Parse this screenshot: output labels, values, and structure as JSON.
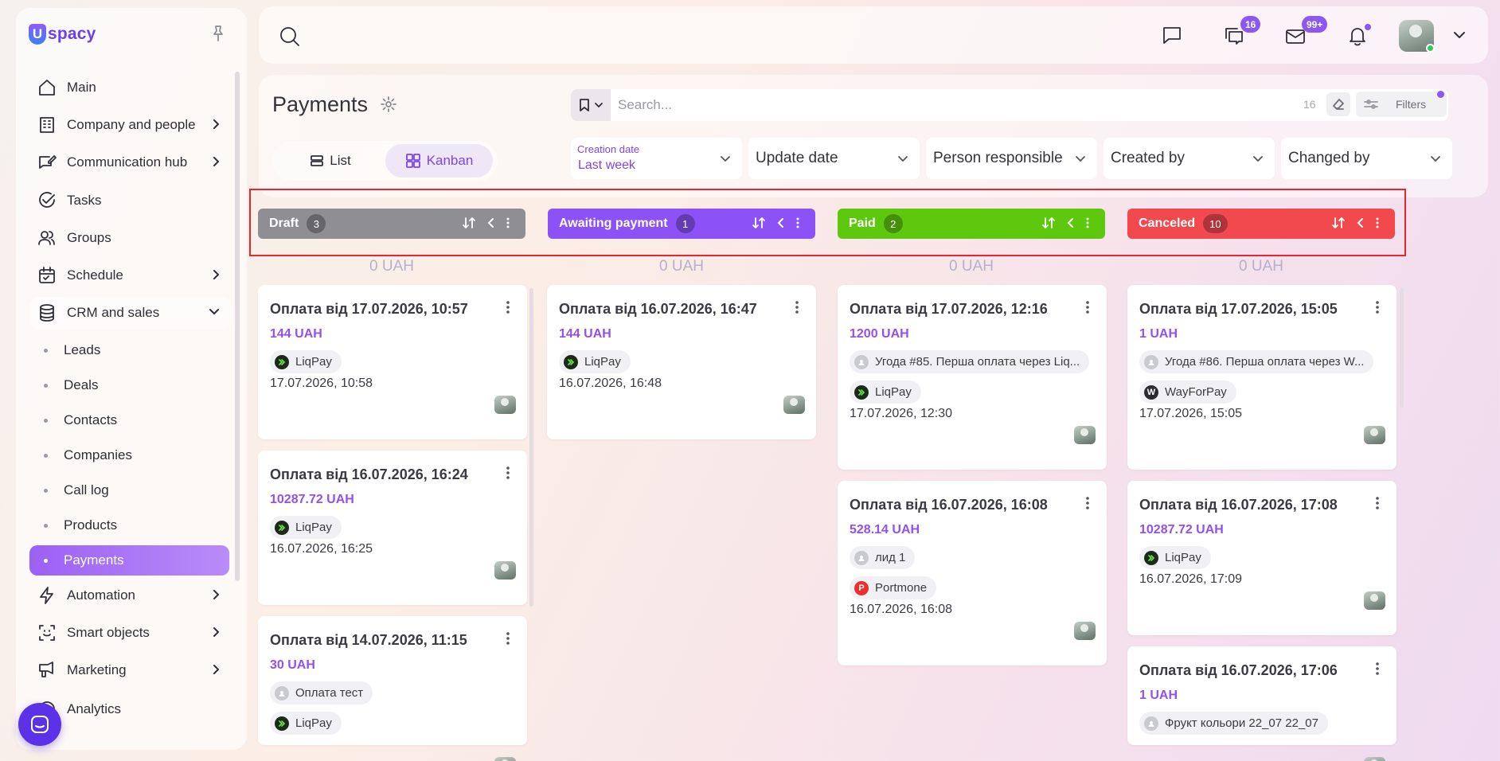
{
  "sidebar": {
    "logo": {
      "letter": "U",
      "text": "spacy"
    },
    "items": [
      {
        "label": "Main"
      },
      {
        "label": "Company and people"
      },
      {
        "label": "Communication hub"
      },
      {
        "label": "Tasks"
      },
      {
        "label": "Groups"
      },
      {
        "label": "Schedule"
      },
      {
        "label": "CRM and sales"
      },
      {
        "label": "Automation"
      },
      {
        "label": "Smart objects"
      },
      {
        "label": "Marketing"
      },
      {
        "label": "Analytics"
      }
    ],
    "crm_subitems": [
      {
        "label": "Leads"
      },
      {
        "label": "Deals"
      },
      {
        "label": "Contacts"
      },
      {
        "label": "Companies"
      },
      {
        "label": "Call log"
      },
      {
        "label": "Products"
      },
      {
        "label": "Payments"
      }
    ]
  },
  "topbar": {
    "chats_badge": "16",
    "mail_badge": "99+"
  },
  "header": {
    "title": "Payments",
    "views": {
      "list": "List",
      "kanban": "Kanban"
    },
    "search_placeholder": "Search...",
    "search_count": "16",
    "filters_label": "Filters",
    "filters": {
      "creation_date": {
        "label": "Creation date",
        "value": "Last week"
      },
      "update_date": "Update date",
      "person_responsible": "Person responsible",
      "created_by": "Created by",
      "changed_by": "Changed by"
    }
  },
  "columns": [
    {
      "name": "Draft",
      "count": "3",
      "total": "0 UAH",
      "color": "#8e8e93",
      "cards": [
        {
          "title": "Оплата від 17.07.2026, 10:57",
          "amount": "144 UAH",
          "chips": [
            {
              "label": "LiqPay",
              "icon": "liqpay-icon"
            }
          ],
          "date": "17.07.2026, 10:58"
        },
        {
          "title": "Оплата від 16.07.2026, 16:24",
          "amount": "10287.72 UAH",
          "chips": [
            {
              "label": "LiqPay",
              "icon": "liqpay-icon"
            }
          ],
          "date": "16.07.2026, 16:25"
        },
        {
          "title": "Оплата від 14.07.2026, 11:15",
          "amount": "30 UAH",
          "chips": [
            {
              "label": "Оплата тест",
              "icon": "contact-icon"
            },
            {
              "label": "LiqPay",
              "icon": "liqpay-icon"
            }
          ],
          "date": ""
        }
      ]
    },
    {
      "name": "Awaiting payment",
      "count": "1",
      "total": "0 UAH",
      "color": "#8c52f5",
      "cards": [
        {
          "title": "Оплата від 16.07.2026, 16:47",
          "amount": "144 UAH",
          "chips": [
            {
              "label": "LiqPay",
              "icon": "liqpay-icon"
            }
          ],
          "date": "16.07.2026, 16:48"
        }
      ]
    },
    {
      "name": "Paid",
      "count": "2",
      "total": "0 UAH",
      "color": "#5ec80e",
      "cards": [
        {
          "title": "Оплата від 17.07.2026, 12:16",
          "amount": "1200 UAH",
          "chips": [
            {
              "label": "Угода #85. Перша оплата через Liq...",
              "icon": "contact-icon"
            },
            {
              "label": "LiqPay",
              "icon": "liqpay-icon"
            }
          ],
          "date": "17.07.2026, 12:30"
        },
        {
          "title": "Оплата від 16.07.2026, 16:08",
          "amount": "528.14 UAH",
          "chips": [
            {
              "label": "лид 1",
              "icon": "contact-icon"
            },
            {
              "label": "Portmone",
              "icon": "portmone-icon"
            }
          ],
          "date": "16.07.2026, 16:08"
        }
      ]
    },
    {
      "name": "Canceled",
      "count": "10",
      "total": "0 UAH",
      "color": "#f2494f",
      "cards": [
        {
          "title": "Оплата від 17.07.2026, 15:05",
          "amount": "1 UAH",
          "chips": [
            {
              "label": "Угода #86. Перша оплата через W...",
              "icon": "contact-icon"
            },
            {
              "label": "WayForPay",
              "icon": "wayforpay-icon"
            }
          ],
          "date": "17.07.2026, 15:05"
        },
        {
          "title": "Оплата від 16.07.2026, 17:08",
          "amount": "10287.72 UAH",
          "chips": [
            {
              "label": "LiqPay",
              "icon": "liqpay-icon"
            }
          ],
          "date": "16.07.2026, 17:09"
        },
        {
          "title": "Оплата від 16.07.2026, 17:06",
          "amount": "1 UAH",
          "chips": [
            {
              "label": "Фрукт кольори 22_07 22_07",
              "icon": "contact-icon"
            }
          ],
          "date": ""
        }
      ]
    }
  ]
}
